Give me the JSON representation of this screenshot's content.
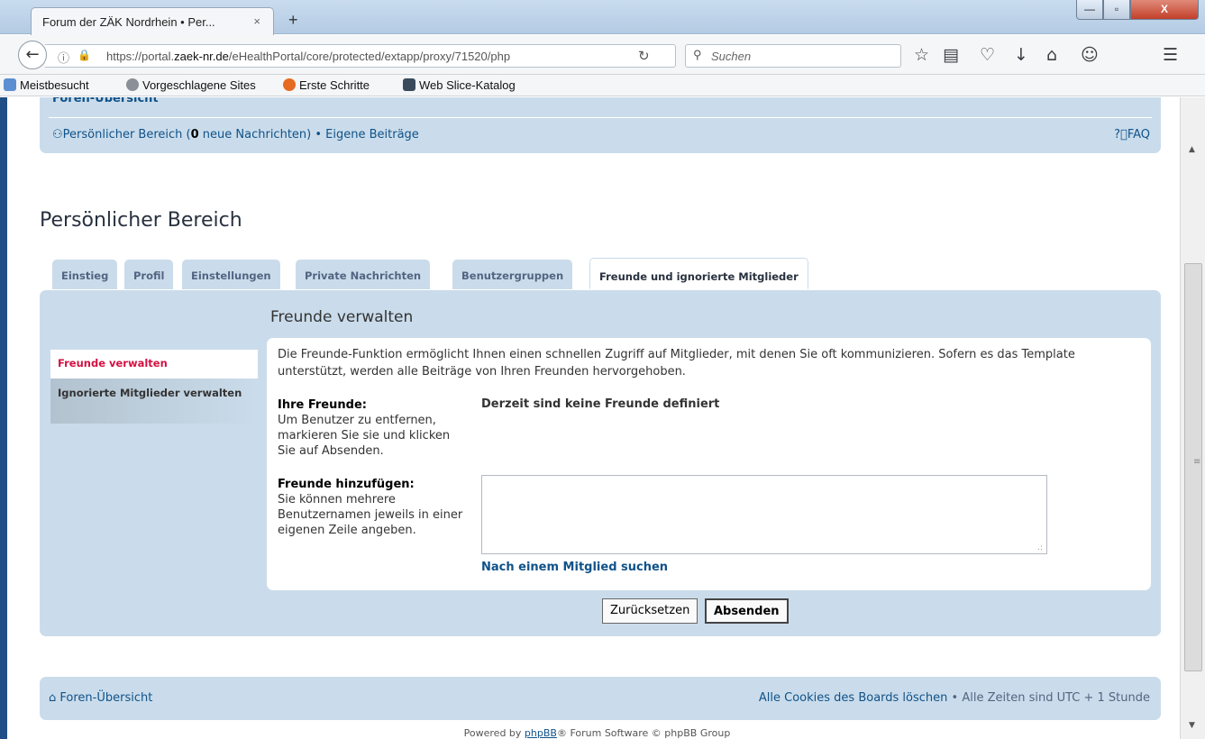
{
  "browser": {
    "tab_title": "Forum der ZÄK Nordrhein • Per...",
    "tab_close": "×",
    "new_tab": "+",
    "window_min": "—",
    "window_max": "▫",
    "window_close": "X",
    "url_prefix": "https://portal.",
    "url_domain": "zaek-nr.de",
    "url_path": "/eHealthPortal/core/protected/extapp/proxy/71520/php",
    "search_placeholder": "Suchen",
    "bookmarks": [
      "Meistbesucht",
      "Vorgeschlagene Sites",
      "Erste Schritte",
      "Web Slice-Katalog"
    ]
  },
  "forum": {
    "nav_cutoff": "Foren-Übersicht",
    "personal_prefix": "Persönlicher Bereich (",
    "new_messages_count": "0",
    "personal_suffix": " neue Nachrichten) • Eigene Beiträge",
    "faq": "FAQ",
    "page_title": "Persönlicher Bereich",
    "tabs": [
      {
        "label": "Einstieg"
      },
      {
        "label": "Profil"
      },
      {
        "label": "Einstellungen"
      },
      {
        "label": "Private Nachrichten"
      },
      {
        "label": "Benutzergruppen"
      },
      {
        "label": "Freunde und ignorierte Mitglieder"
      }
    ],
    "panel_title": "Freunde verwalten",
    "side_menu": [
      {
        "label": "Freunde verwalten"
      },
      {
        "label": "Ignorierte Mitglieder verwalten"
      }
    ],
    "description": "Die Freunde-Funktion ermöglicht Ihnen einen schnellen Zugriff auf Mitglieder, mit denen Sie oft kommunizieren. Sofern es das Template unterstützt, werden alle Beiträge von Ihren Freunden hervorgehoben.",
    "your_friends_label": "Ihre Freunde:",
    "your_friends_hint": "Um Benutzer zu entfernen, markieren Sie sie und klicken Sie auf Absenden.",
    "no_friends": "Derzeit sind keine Freunde definiert",
    "add_friends_label": "Freunde hinzufügen:",
    "add_friends_hint": "Sie können mehrere Benutzernamen jeweils in einer eigenen Zeile angeben.",
    "add_friends_value": "",
    "search_member_link": "Nach einem Mitglied suchen",
    "reset_button": "Zurücksetzen",
    "submit_button": "Absenden",
    "footer_home": "Foren-Übersicht",
    "footer_cookies": "Alle Cookies des Boards löschen",
    "footer_timezone": " • Alle Zeiten sind UTC + 1 Stunde",
    "powered_prefix": "Powered by ",
    "powered_link": "phpBB",
    "powered_suffix": "® Forum Software © phpBB Group"
  },
  "colors": {
    "panel_bg": "#cadceb",
    "link": "#105289",
    "active_menu": "#d31141"
  }
}
